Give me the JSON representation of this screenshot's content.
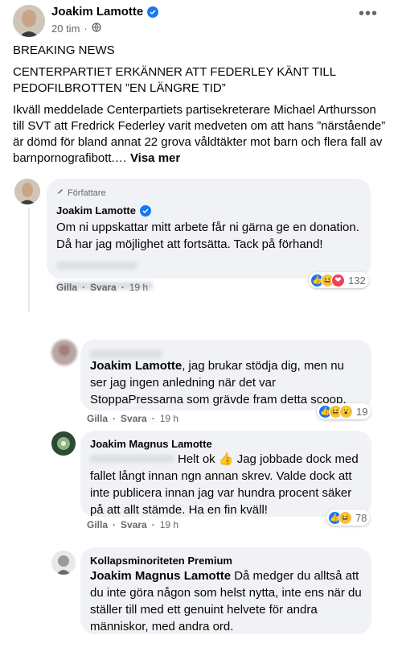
{
  "post": {
    "author": "Joakim Lamotte",
    "time": "20 tim",
    "headline": "BREAKING NEWS",
    "subheadline": "CENTERPARTIET ERKÄNNER ATT FEDERLEY KÄNT TILL PEDOFILBROTTEN ”EN LÄNGRE TID”",
    "body": "Ikväll meddelade Centerpartiets partisekreterare Michael Arthursson till SVT att Fredrick Federley varit medveten om att hans ”närstående” är dömd för bland annat 22 grova våldtäkter mot barn och flera fall av barnpornografibott.…",
    "see_more": "Visa mer"
  },
  "comments": [
    {
      "badge": "Författare",
      "author": "Joakim Lamotte",
      "text": "Om ni uppskattar mitt arbete får ni gärna ge en donation. Då har jag möjlighet att fortsätta. Tack på förhand!",
      "like": "Gilla",
      "reply": "Svara",
      "time": "19 h",
      "reaction_count": "132",
      "reaction_icons": [
        "like-icon",
        "haha-icon",
        "love-icon"
      ]
    },
    {
      "mention": "Joakim Lamotte",
      "text": ", jag brukar stödja dig, men nu ser jag ingen anledning när det var StoppaPressarna som grävde fram detta scoop.",
      "like": "Gilla",
      "reply": "Svara",
      "time": "19 h",
      "reaction_count": "19",
      "reaction_icons": [
        "like-icon",
        "haha-icon",
        "wow-icon"
      ]
    },
    {
      "author": "Joakim Magnus Lamotte",
      "text_before": "Helt ok",
      "text_after": "Jag jobbade dock med fallet långt innan ngn annan skrev. Valde dock att inte publicera innan jag var hundra procent säker på att allt stämde. Ha en fin kväll!",
      "like": "Gilla",
      "reply": "Svara",
      "time": "19 h",
      "reaction_count": "78",
      "reaction_icons": [
        "like-icon",
        "haha-icon"
      ]
    },
    {
      "author": "Kollapsminoriteten Premium",
      "mention": "Joakim Magnus Lamotte",
      "text": "Då medger du alltså att du inte göra någon som helst nytta, inte ens när du ställer till med ett genuint helvete för andra människor, med andra ord."
    }
  ],
  "colors": {
    "facebook_blue": "#1877f2",
    "bubble": "#f0f2f5",
    "meta": "#65676b"
  }
}
